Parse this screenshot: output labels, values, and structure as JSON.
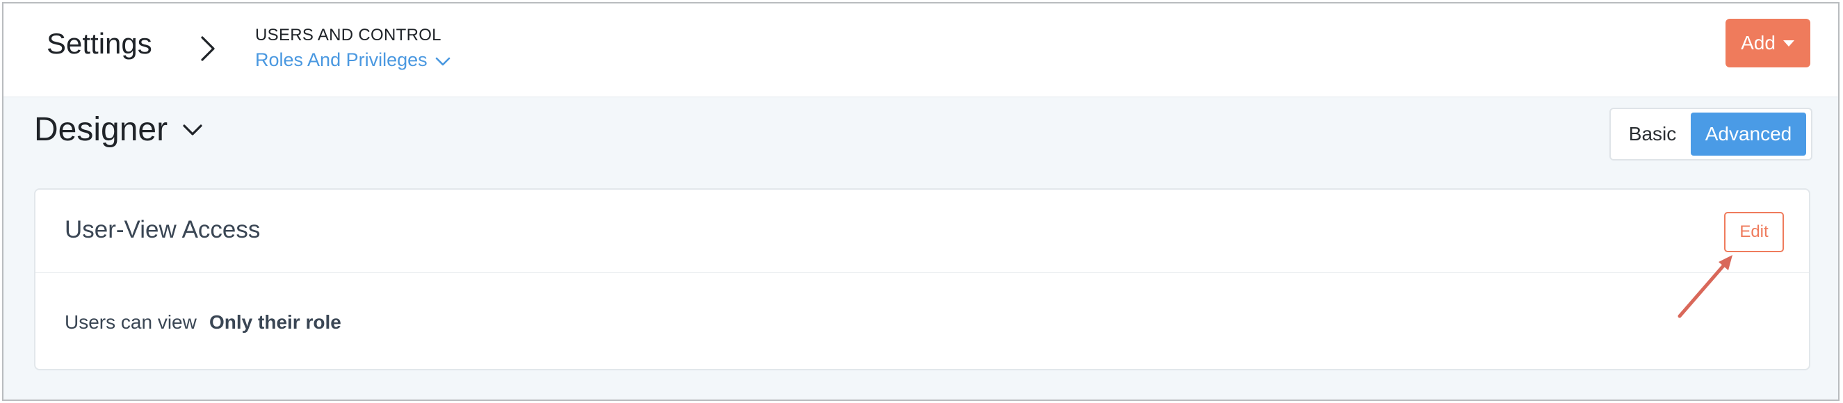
{
  "header": {
    "page_heading": "Settings",
    "breadcrumb": {
      "section": "USERS AND CONTROL",
      "current": "Roles And Privileges"
    },
    "add_button_label": "Add"
  },
  "role": {
    "name": "Designer"
  },
  "view_toggle": {
    "options": [
      "Basic",
      "Advanced"
    ],
    "selected": "Advanced"
  },
  "card": {
    "title": "User-View Access",
    "edit_label": "Edit",
    "setting": {
      "label": "Users can view",
      "value": "Only their role"
    }
  },
  "colors": {
    "accent_blue": "#4a98e0",
    "accent_orange": "#ef7b5c",
    "annotation_arrow": "#d9685a"
  },
  "icons": {
    "breadcrumb_separator": "chevron-right-icon",
    "breadcrumb_dropdown": "chevron-down-icon",
    "add_dropdown": "caret-down-icon",
    "role_dropdown": "chevron-down-icon"
  }
}
